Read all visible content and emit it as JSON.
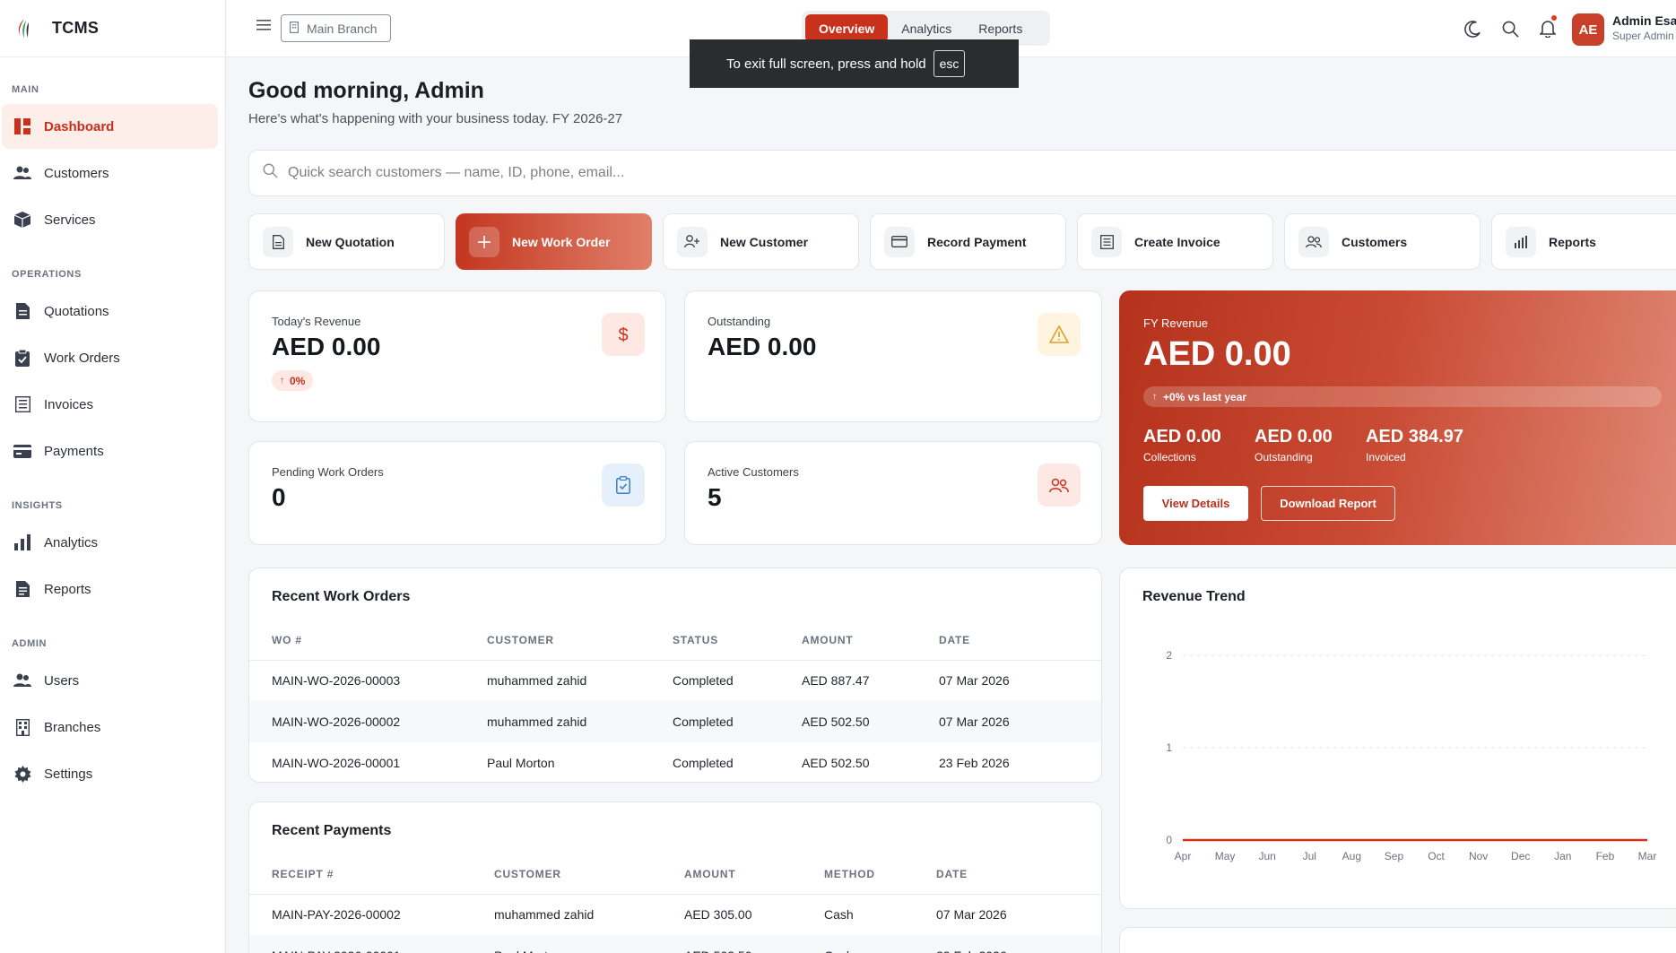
{
  "brand": {
    "name": "TCMS"
  },
  "sidebar": {
    "sections": [
      {
        "label": "MAIN",
        "items": [
          {
            "label": "Dashboard",
            "icon": "dashboard-icon"
          },
          {
            "label": "Customers",
            "icon": "users-icon"
          },
          {
            "label": "Services",
            "icon": "box-icon"
          }
        ]
      },
      {
        "label": "OPERATIONS",
        "items": [
          {
            "label": "Quotations",
            "icon": "document-icon"
          },
          {
            "label": "Work Orders",
            "icon": "clipboard-icon"
          },
          {
            "label": "Invoices",
            "icon": "receipt-icon"
          },
          {
            "label": "Payments",
            "icon": "card-icon"
          }
        ]
      },
      {
        "label": "INSIGHTS",
        "items": [
          {
            "label": "Analytics",
            "icon": "bar-chart-icon"
          },
          {
            "label": "Reports",
            "icon": "report-icon"
          }
        ]
      },
      {
        "label": "ADMIN",
        "items": [
          {
            "label": "Users",
            "icon": "users-icon"
          },
          {
            "label": "Branches",
            "icon": "building-icon"
          },
          {
            "label": "Settings",
            "icon": "gear-icon"
          }
        ]
      }
    ]
  },
  "topbar": {
    "branch": "Main Branch",
    "tabs": [
      "Overview",
      "Analytics",
      "Reports"
    ],
    "user": {
      "initials": "AE",
      "name": "Admin Esa",
      "role": "Super Admin"
    }
  },
  "toast": {
    "text": "To exit full screen, press and hold",
    "key": "esc"
  },
  "header": {
    "greeting": "Good morning, Admin",
    "subtitle": "Here's what's happening with your business today. FY 2026-27"
  },
  "search": {
    "placeholder": "Quick search customers — name, ID, phone, email..."
  },
  "quick_actions": [
    "New Quotation",
    "New Work Order",
    "New Customer",
    "Record Payment",
    "Create Invoice",
    "Customers",
    "Reports"
  ],
  "stats": {
    "todays_revenue": {
      "label": "Today's Revenue",
      "value": "AED 0.00",
      "trend": "0%"
    },
    "outstanding": {
      "label": "Outstanding",
      "value": "AED 0.00"
    },
    "pending_work_orders": {
      "label": "Pending Work Orders",
      "value": "0"
    },
    "active_customers": {
      "label": "Active Customers",
      "value": "5"
    }
  },
  "fy_revenue": {
    "label": "FY Revenue",
    "value": "AED 0.00",
    "trend": "+0% vs last year",
    "collections": {
      "value": "AED 0.00",
      "label": "Collections"
    },
    "outstanding": {
      "value": "AED 0.00",
      "label": "Outstanding"
    },
    "invoiced": {
      "value": "AED 384.97",
      "label": "Invoiced"
    },
    "view_details": "View Details",
    "download_report": "Download Report"
  },
  "recent_work_orders": {
    "title": "Recent Work Orders",
    "columns": [
      "WO #",
      "CUSTOMER",
      "STATUS",
      "AMOUNT",
      "DATE"
    ],
    "rows": [
      [
        "MAIN-WO-2026-00003",
        "muhammed zahid",
        "Completed",
        "AED 887.47",
        "07 Mar 2026"
      ],
      [
        "MAIN-WO-2026-00002",
        "muhammed zahid",
        "Completed",
        "AED 502.50",
        "07 Mar 2026"
      ],
      [
        "MAIN-WO-2026-00001",
        "Paul Morton",
        "Completed",
        "AED 502.50",
        "23 Feb 2026"
      ]
    ]
  },
  "recent_payments": {
    "title": "Recent Payments",
    "columns": [
      "RECEIPT #",
      "CUSTOMER",
      "AMOUNT",
      "METHOD",
      "DATE"
    ],
    "rows": [
      [
        "MAIN-PAY-2026-00002",
        "muhammed zahid",
        "AED 305.00",
        "Cash",
        "07 Mar 2026"
      ],
      [
        "MAIN-PAY-2026-00001",
        "Paul Morton",
        "AED 502.50",
        "Cash",
        "23 Feb 2026"
      ]
    ]
  },
  "chart_data": {
    "type": "line",
    "title": "Revenue Trend",
    "x": [
      "Apr",
      "May",
      "Jun",
      "Jul",
      "Aug",
      "Sep",
      "Oct",
      "Nov",
      "Dec",
      "Jan",
      "Feb",
      "Mar"
    ],
    "series": [
      {
        "values": [
          0,
          0,
          0,
          0,
          0,
          0,
          0,
          0,
          0,
          0,
          0,
          0
        ],
        "color": "#d0311b"
      }
    ],
    "ylim": [
      0,
      2
    ],
    "yticks": [
      "0",
      "1",
      "2"
    ],
    "grid": true
  },
  "colors": {
    "accent": "#c8321c",
    "accent_light": "#fdeeea"
  }
}
